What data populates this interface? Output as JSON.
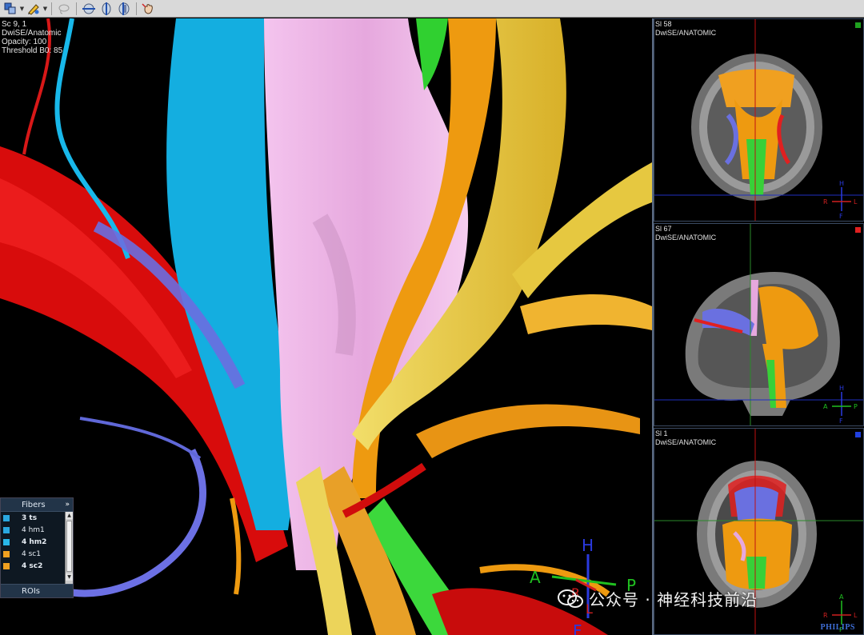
{
  "main_view": {
    "overlay": [
      "Sc 9, 1",
      "DwiSE/Anatomic",
      "Opacity: 100",
      "Threshold B0: 85"
    ],
    "orientation": {
      "h": "H",
      "a": "A",
      "p": "P",
      "f": "F",
      "r": "R",
      "l": "L"
    }
  },
  "fibers_panel": {
    "title": "Fibers",
    "expand_symbol": "»",
    "items": [
      {
        "label": "3 ts",
        "color": "#2aa8e0",
        "bold": true
      },
      {
        "label": "4 hm1",
        "color": "#2aa8e0",
        "bold": false
      },
      {
        "label": "4 hm2",
        "color": "#29b7e8",
        "bold": true
      },
      {
        "label": "4 sc1",
        "color": "#f0a020",
        "bold": false
      },
      {
        "label": "4 sc2",
        "color": "#f0a020",
        "bold": true
      }
    ],
    "rois_label": "ROIs"
  },
  "views": [
    {
      "slice": "Sl 58",
      "series": "DwiSE/ANATOMIC",
      "marker_color": "#1fa01f",
      "orient": {
        "top": "H",
        "left": "R",
        "right": "L",
        "bottom": "F"
      }
    },
    {
      "slice": "Sl 67",
      "series": "DwiSE/ANATOMIC",
      "marker_color": "#e02020",
      "orient": {
        "top": "H",
        "left": "A",
        "right": "P",
        "bottom": "F"
      }
    },
    {
      "slice": "Sl 1",
      "series": "DwiSE/ANATOMIC",
      "marker_color": "#2040e0",
      "orient": {
        "top": "A",
        "left": "R",
        "right": "L",
        "bottom": "P"
      }
    }
  ],
  "watermark": "公众号 · 神经科技前沿",
  "brand": "PHILIPS",
  "colors": {
    "red": "#e01010",
    "cyan": "#18b4e4",
    "pink": "#f0b4e8",
    "yellow": "#eed24a",
    "orange": "#ee9a10",
    "green": "#38d838",
    "blue": "#6870e0"
  }
}
